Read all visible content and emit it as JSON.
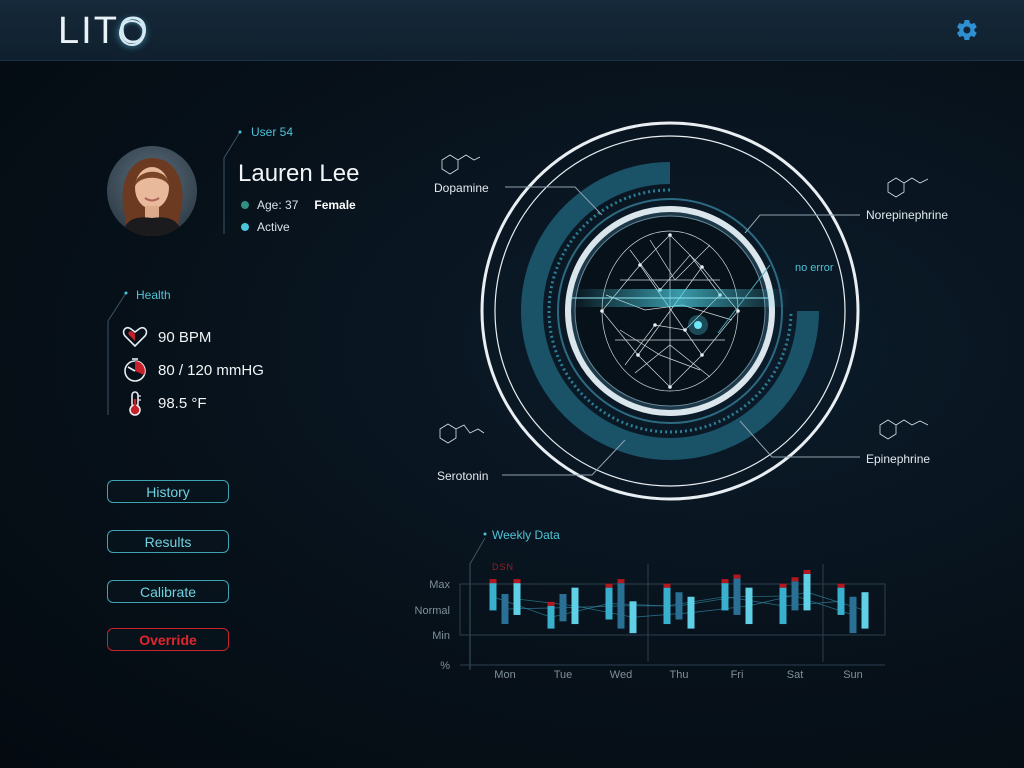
{
  "app": {
    "title": "LITO"
  },
  "colors": {
    "accent": "#4ec3d6",
    "danger": "#e1262d",
    "background": "#07111a"
  },
  "user": {
    "id_label": "User 54",
    "name": "Lauren Lee",
    "age_label": "Age: 37",
    "gender": "Female",
    "status": "Active"
  },
  "health": {
    "title": "Health",
    "heart_rate": "90 BPM",
    "blood_pressure": "80 / 120 mmHG",
    "temperature": "98.5 °F"
  },
  "buttons": {
    "history": "History",
    "results": "Results",
    "calibrate": "Calibrate",
    "override": "Override"
  },
  "neuro": {
    "status": "no error",
    "molecules": {
      "dopamine": "Dopamine",
      "norepinephrine": "Norepinephrine",
      "serotonin": "Serotonin",
      "epinephrine": "Epinephrine"
    }
  },
  "chart_data": {
    "type": "bar",
    "title": "Weekly Data",
    "legend": "DSN",
    "y_ticks": [
      "Max",
      "Normal",
      "Min",
      "%"
    ],
    "categories": [
      "Mon",
      "Tue",
      "Wed",
      "Thu",
      "Fri",
      "Sat",
      "Sun"
    ],
    "ylim": [
      0,
      100
    ],
    "series": [
      {
        "values": [
          [
            60,
            90
          ],
          [
            40,
            65
          ],
          [
            50,
            85
          ],
          [
            45,
            85
          ],
          [
            60,
            90
          ],
          [
            45,
            85
          ],
          [
            55,
            85
          ]
        ]
      },
      {
        "values": [
          [
            45,
            78
          ],
          [
            48,
            78
          ],
          [
            40,
            90
          ],
          [
            50,
            80
          ],
          [
            55,
            95
          ],
          [
            60,
            92
          ],
          [
            35,
            75
          ]
        ]
      },
      {
        "values": [
          [
            55,
            90
          ],
          [
            45,
            85
          ],
          [
            35,
            70
          ],
          [
            40,
            75
          ],
          [
            45,
            85
          ],
          [
            60,
            100
          ],
          [
            40,
            80
          ]
        ]
      }
    ]
  }
}
